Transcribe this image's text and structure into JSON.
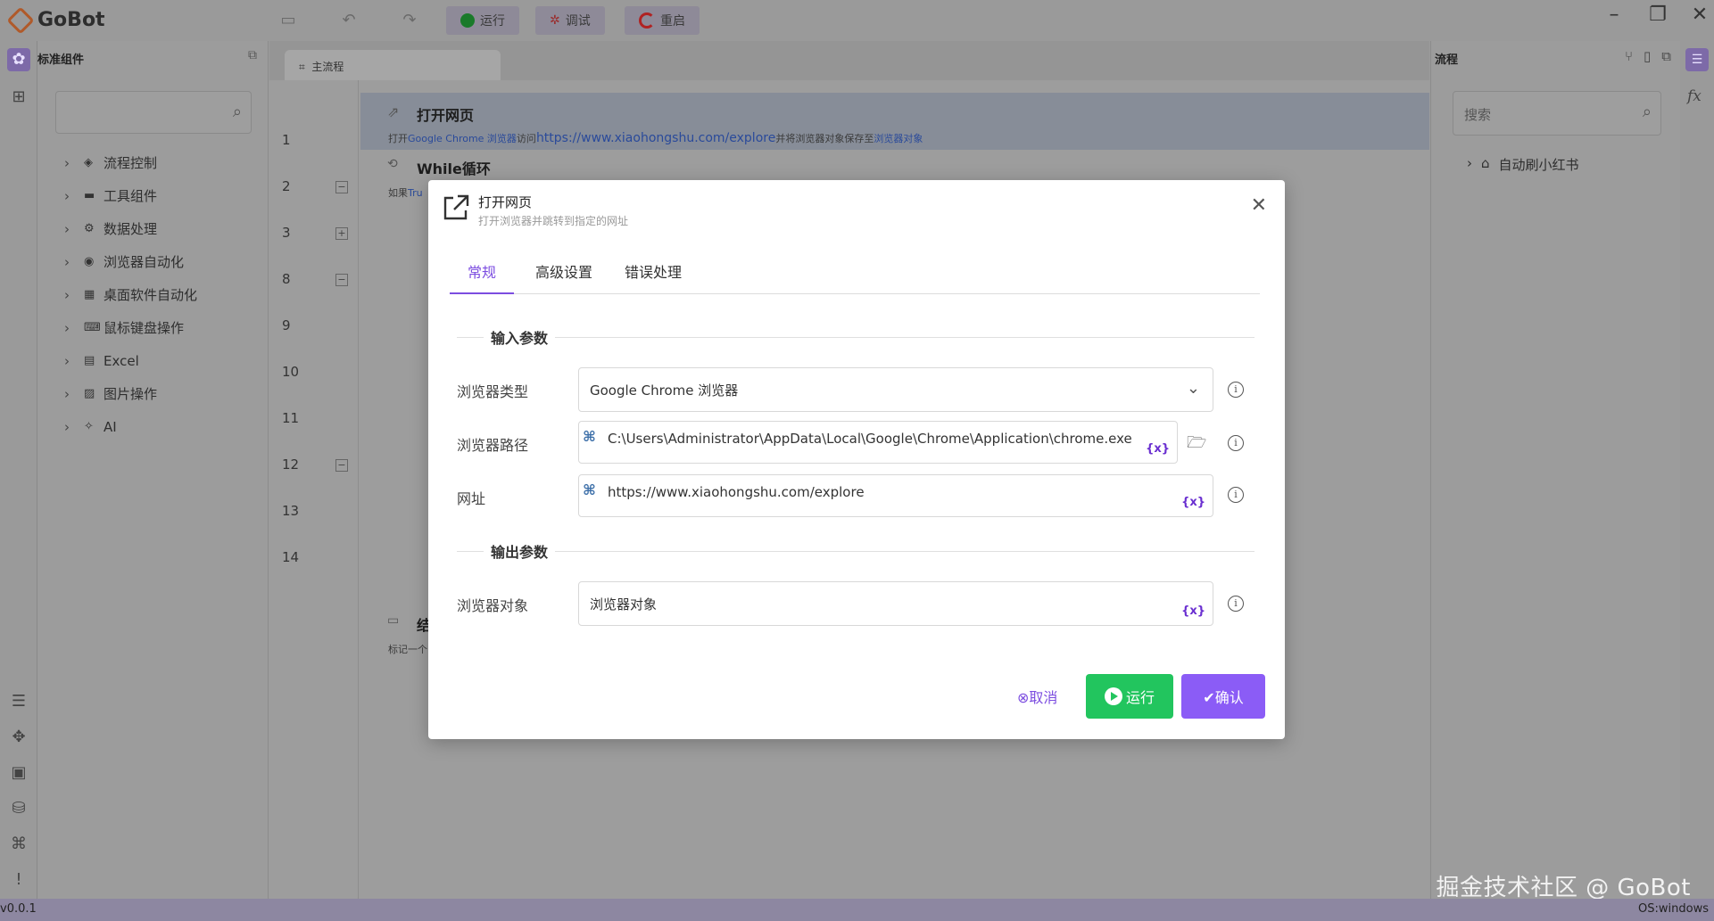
{
  "app": {
    "name": "GoBot",
    "version": "v0.0.1",
    "os": "OS:windows"
  },
  "toolbar": {
    "run": "运行",
    "debug": "调试",
    "restart": "重启"
  },
  "left_panel": {
    "title": "标准组件",
    "tree": [
      {
        "label": "流程控制",
        "icon": "flow-icon"
      },
      {
        "label": "工具组件",
        "icon": "toolbox-icon"
      },
      {
        "label": "数据处理",
        "icon": "data-icon"
      },
      {
        "label": "浏览器自动化",
        "icon": "chrome-icon"
      },
      {
        "label": "桌面软件自动化",
        "icon": "windows-icon"
      },
      {
        "label": "鼠标键盘操作",
        "icon": "keyboard-icon"
      },
      {
        "label": "Excel",
        "icon": "excel-icon"
      },
      {
        "label": "图片操作",
        "icon": "image-icon"
      },
      {
        "label": "AI",
        "icon": "ai-icon"
      }
    ]
  },
  "editor": {
    "tab": "主流程",
    "line_numbers": [
      "1",
      "2",
      "3",
      "8",
      "9",
      "10",
      "11",
      "12",
      "13",
      "14"
    ],
    "row1": {
      "title": "打开网页",
      "desc_prefix": "打开",
      "desc_browser": "Google Chrome 浏览器",
      "desc_mid": "访问",
      "desc_url": "https://www.xiaohongshu.com/explore",
      "desc_mid2": "并将浏览器对象保存至",
      "desc_var": "浏览器对象"
    },
    "row2": {
      "title": "While循环",
      "desc_prefix": "如果",
      "desc_cond": "Tru"
    },
    "row14": {
      "title": "结",
      "desc": "标记一个"
    }
  },
  "right_panel": {
    "title": "流程",
    "search_placeholder": "搜索",
    "tree_item": "自动刷小红书"
  },
  "dialog": {
    "title": "打开网页",
    "subtitle": "打开浏览器并跳转到指定的网址",
    "tabs": [
      "常规",
      "高级设置",
      "错误处理"
    ],
    "input_section": "输入参数",
    "output_section": "输出参数",
    "fields": {
      "browser_type_label": "浏览器类型",
      "browser_type_value": "Google Chrome 浏览器",
      "browser_path_label": "浏览器路径",
      "browser_path_value": "C:\\Users\\Administrator\\AppData\\Local\\Google\\Chrome\\Application\\chrome.exe",
      "url_label": "网址",
      "url_value": "https://www.xiaohongshu.com/explore",
      "browser_obj_label": "浏览器对象",
      "browser_obj_value": "浏览器对象"
    },
    "var_token": "{x}",
    "buttons": {
      "cancel": "⊗取消",
      "run": "运行",
      "confirm": "✔确认"
    }
  },
  "watermark": "掘金技术社区 @ GoBot",
  "colors": {
    "accent": "#7c4de0",
    "run_green": "#22c55e",
    "confirm_purple": "#8b5cf6"
  }
}
